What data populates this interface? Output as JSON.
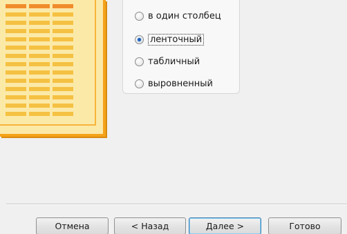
{
  "layout_options": [
    {
      "label": "в один столбец",
      "checked": false
    },
    {
      "label": "ленточный",
      "checked": true
    },
    {
      "label": "табличный",
      "checked": false
    },
    {
      "label": "выровненный",
      "checked": false
    }
  ],
  "buttons": {
    "cancel": "Отмена",
    "back": "< Назад",
    "next": "Далее >",
    "finish": "Готово"
  },
  "colors": {
    "preview_fill": "#fbe9a8",
    "preview_border": "#f5a219",
    "preview_header_cell": "#f08c2b",
    "preview_cell": "#f5c142",
    "radio_dot": "#1f5eb8"
  }
}
